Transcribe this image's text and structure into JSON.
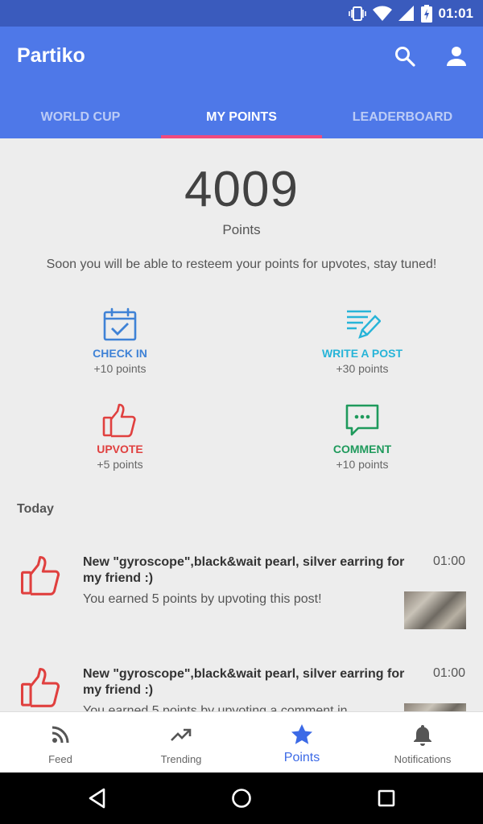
{
  "status_bar": {
    "time": "01:01"
  },
  "app_bar": {
    "title": "Partiko"
  },
  "tabs": [
    "WORLD CUP",
    "MY POINTS",
    "LEADERBOARD"
  ],
  "points": {
    "total": "4009",
    "label": "Points",
    "notice": "Soon you will be able to resteem your points for upvotes, stay tuned!"
  },
  "actions": [
    {
      "label": "CHECK IN",
      "points": "+10 points",
      "icon": "calendar-check-icon",
      "color": "#3f82d6"
    },
    {
      "label": "WRITE A POST",
      "points": "+30 points",
      "icon": "write-post-icon",
      "color": "#27b4d8"
    },
    {
      "label": "UPVOTE",
      "points": "+5 points",
      "icon": "thumbs-up-icon",
      "color": "#e0403f"
    },
    {
      "label": "COMMENT",
      "points": "+10 points",
      "icon": "comment-icon",
      "color": "#1f9a5c"
    }
  ],
  "section_today": "Today",
  "activities": [
    {
      "title": "New \"gyroscope\",black&wait pearl, silver earring for my friend :)",
      "time": "01:00",
      "description": "You earned 5 points by upvoting this post!"
    },
    {
      "title": "New \"gyroscope\",black&wait pearl, silver earring for my friend :)",
      "time": "01:00",
      "description": "You earned 5 points by upvoting a comment in"
    }
  ],
  "bottom_nav": [
    "Feed",
    "Trending",
    "Points",
    "Notifications"
  ],
  "colors": {
    "primary": "#4e78e8",
    "status_bar": "#3a5bbd",
    "tab_indicator": "#ef4a7e",
    "active_nav": "#3c6ae6"
  }
}
